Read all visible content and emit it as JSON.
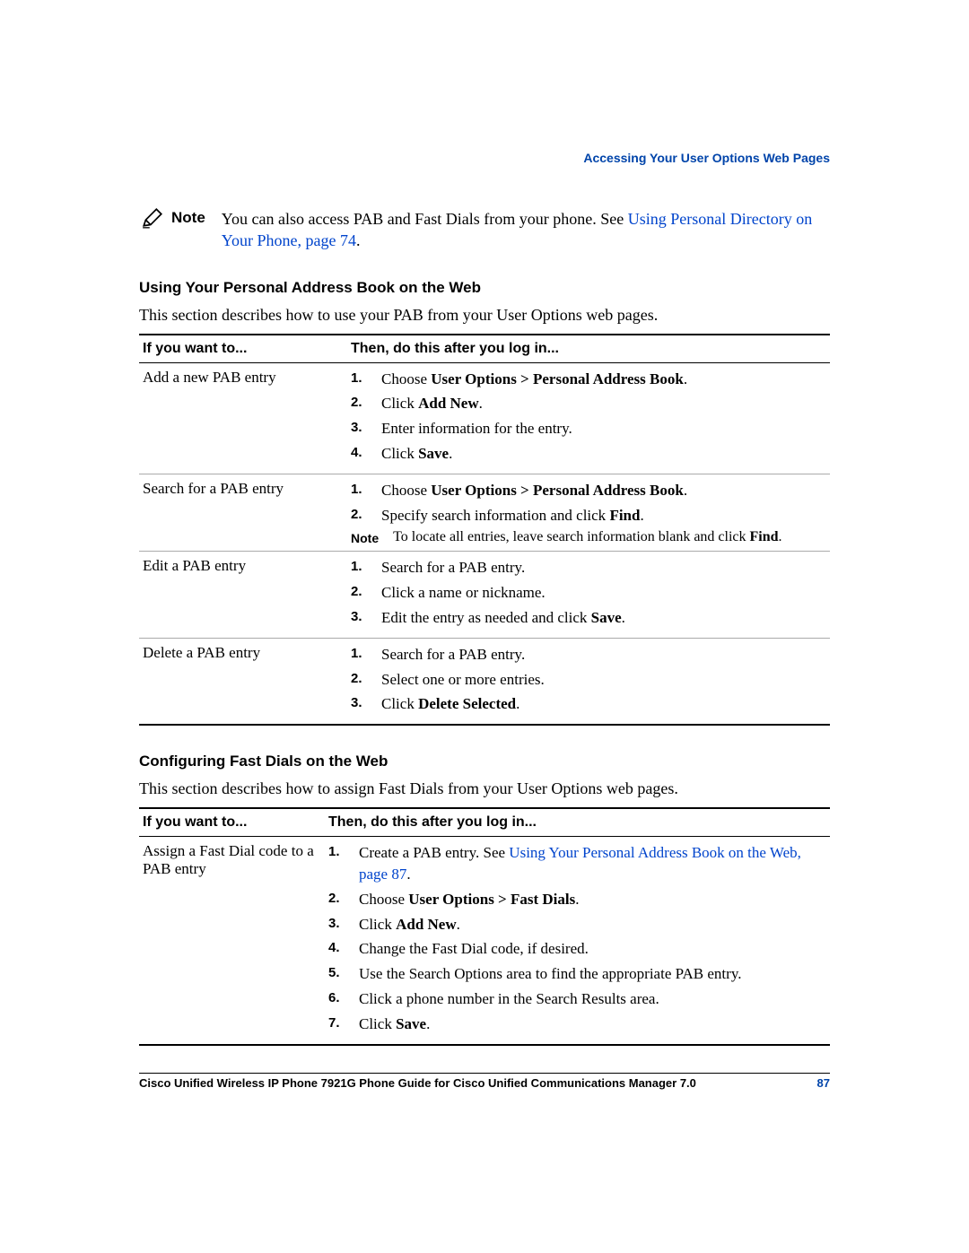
{
  "header": {
    "running_head": "Accessing Your User Options Web Pages"
  },
  "top_note": {
    "label": "Note",
    "text_prefix": "You can also access PAB and Fast Dials from your phone. See ",
    "link_text": "Using Personal Directory on Your Phone, page 74",
    "text_suffix": "."
  },
  "section1": {
    "heading": "Using Your Personal Address Book on the Web",
    "intro": "This section describes how to use your PAB from your User Options web pages.",
    "th_if": "If you want to...",
    "th_then": "Then, do this after you log in...",
    "rows": {
      "r1_if": "Add a new PAB entry",
      "r1s1_a": "Choose ",
      "r1s1_b": "User Options > Personal Address Book",
      "r1s1_c": ".",
      "r1s2_a": "Click ",
      "r1s2_b": "Add New",
      "r1s2_c": ".",
      "r1s3": "Enter information for the entry.",
      "r1s4_a": "Click ",
      "r1s4_b": "Save",
      "r1s4_c": ".",
      "r2_if": "Search for a PAB entry",
      "r2s1_a": "Choose ",
      "r2s1_b": "User Options > Personal Address Book",
      "r2s1_c": ".",
      "r2s2_a": "Specify search information and click ",
      "r2s2_b": "Find",
      "r2s2_c": ".",
      "r2note_label": "Note",
      "r2note_a": "To locate all entries, leave search information blank and click ",
      "r2note_b": "Find",
      "r2note_c": ".",
      "r3_if": "Edit a PAB entry",
      "r3s1": "Search for a PAB entry.",
      "r3s2": "Click a name or nickname.",
      "r3s3_a": "Edit the entry as needed and click ",
      "r3s3_b": "Save",
      "r3s3_c": ".",
      "r4_if": "Delete a PAB entry",
      "r4s1": "Search for a PAB entry.",
      "r4s2": "Select one or more entries.",
      "r4s3_a": "Click ",
      "r4s3_b": "Delete Selected",
      "r4s3_c": "."
    }
  },
  "section2": {
    "heading": "Configuring Fast Dials on the Web",
    "intro": "This section describes how to assign Fast Dials from your User Options web pages.",
    "th_if": "If you want to...",
    "th_then": "Then, do this after you log in...",
    "rows": {
      "r1_if": "Assign a Fast Dial code to a PAB entry",
      "r1s1_a": "Create a PAB entry. See ",
      "r1s1_link": "Using Your Personal Address Book on the Web, page 87",
      "r1s1_c": ".",
      "r1s2_a": "Choose ",
      "r1s2_b": "User Options > Fast Dials",
      "r1s2_c": ".",
      "r1s3_a": "Click ",
      "r1s3_b": "Add New",
      "r1s3_c": ".",
      "r1s4": "Change the Fast Dial code, if desired.",
      "r1s5": "Use the Search Options area to find the appropriate PAB entry.",
      "r1s6": "Click a phone number in the Search Results area.",
      "r1s7_a": "Click ",
      "r1s7_b": "Save",
      "r1s7_c": "."
    }
  },
  "footer": {
    "doc_title": "Cisco Unified Wireless IP Phone 7921G Phone Guide for Cisco Unified Communications Manager 7.0",
    "page_number": "87"
  }
}
